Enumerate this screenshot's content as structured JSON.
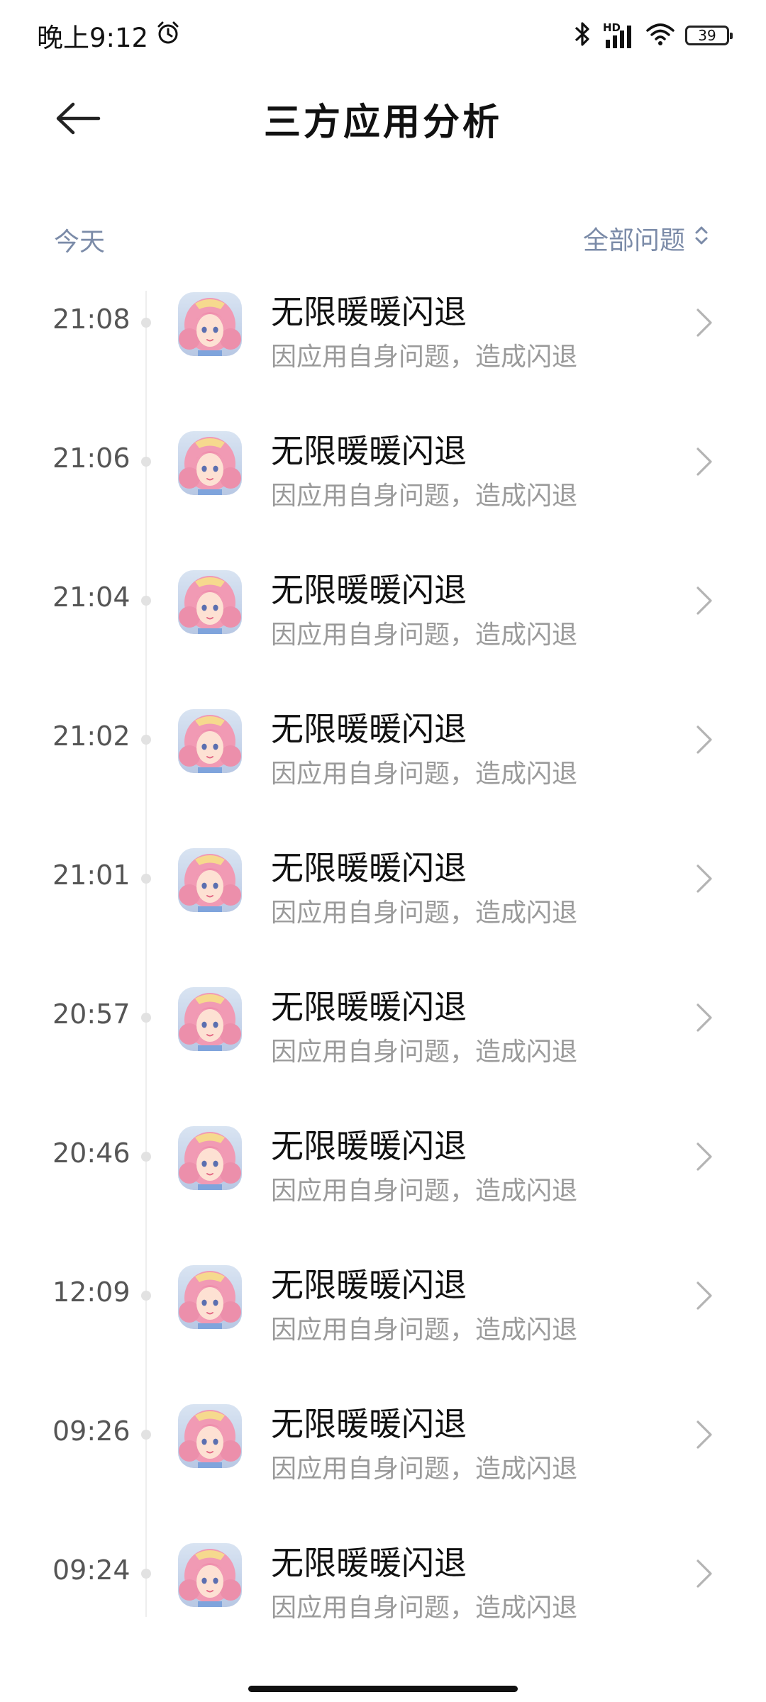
{
  "status_bar": {
    "time": "晚上9:12",
    "network_label": "HD",
    "battery_level": "39",
    "icons": [
      "alarm-icon",
      "bluetooth-icon",
      "signal-icon",
      "wifi-icon",
      "battery-icon"
    ]
  },
  "header": {
    "title": "三方应用分析",
    "back_icon": "back-arrow-icon"
  },
  "filter": {
    "date_label": "今天",
    "dropdown_label": "全部问题",
    "dropdown_icon": "sort-chevrons-icon"
  },
  "colors": {
    "accent_muted": "#7b8ba8",
    "subtitle": "#9a9a9a",
    "timeline": "#eeeeee"
  },
  "items": [
    {
      "time": "21:08",
      "title": "无限暖暖闪退",
      "subtitle": "因应用自身问题，造成闪退"
    },
    {
      "time": "21:06",
      "title": "无限暖暖闪退",
      "subtitle": "因应用自身问题，造成闪退"
    },
    {
      "time": "21:04",
      "title": "无限暖暖闪退",
      "subtitle": "因应用自身问题，造成闪退"
    },
    {
      "time": "21:02",
      "title": "无限暖暖闪退",
      "subtitle": "因应用自身问题，造成闪退"
    },
    {
      "time": "21:01",
      "title": "无限暖暖闪退",
      "subtitle": "因应用自身问题，造成闪退"
    },
    {
      "time": "20:57",
      "title": "无限暖暖闪退",
      "subtitle": "因应用自身问题，造成闪退"
    },
    {
      "time": "20:46",
      "title": "无限暖暖闪退",
      "subtitle": "因应用自身问题，造成闪退"
    },
    {
      "time": "12:09",
      "title": "无限暖暖闪退",
      "subtitle": "因应用自身问题，造成闪退"
    },
    {
      "time": "09:26",
      "title": "无限暖暖闪退",
      "subtitle": "因应用自身问题，造成闪退"
    },
    {
      "time": "09:24",
      "title": "无限暖暖闪退",
      "subtitle": "因应用自身问题，造成闪退"
    }
  ]
}
